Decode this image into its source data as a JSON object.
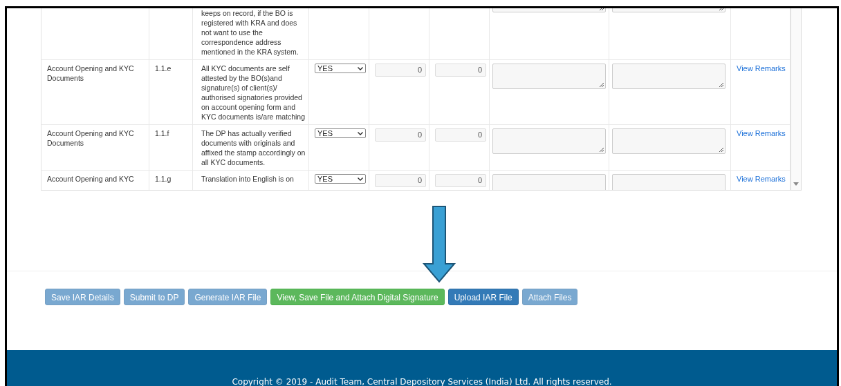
{
  "table": {
    "rows": [
      {
        "kind": "tail",
        "description": "keeps on record, if the BO is registered with KRA and does not want to use the correspondence address mentioned in the KRA system."
      },
      {
        "kind": "full",
        "area": "Account Opening and KYC Documents",
        "code": "1.1.e",
        "description": "All KYC documents are self attested by the BO(s)and signature(s) of client(s)/ authorised signatories provided on account opening form and KYC documents is/are matching",
        "answer": "YES",
        "value_1": "0",
        "value_2": "0",
        "link": "View Remarks"
      },
      {
        "kind": "full",
        "area": "Account Opening and KYC Documents",
        "code": "1.1.f",
        "description": "The DP has actually verified documents with originals and affixed the stamp accordingly on all KYC documents.",
        "answer": "YES",
        "value_1": "0",
        "value_2": "0",
        "link": "View Remarks"
      },
      {
        "kind": "cut",
        "area": "Account Opening and KYC",
        "code": "1.1.g",
        "description": "Translation into English is on",
        "answer": "YES",
        "value_1": "0",
        "value_2": "0",
        "link": "View Remarks"
      }
    ]
  },
  "buttons": [
    {
      "label": "Save IAR Details",
      "kind": "primary",
      "disabled": true
    },
    {
      "label": "Submit to DP",
      "kind": "primary",
      "disabled": true
    },
    {
      "label": "Generate IAR File",
      "kind": "primary",
      "disabled": true
    },
    {
      "label": "View, Save File and Attach Digital Signature",
      "kind": "success",
      "disabled": false
    },
    {
      "label": "Upload IAR File",
      "kind": "primary",
      "disabled": false
    },
    {
      "label": "Attach Files",
      "kind": "primary",
      "disabled": true
    }
  ],
  "footer": {
    "text": "Copyright © 2019 - Audit Team, Central Depository Services (India) Ltd. All rights reserved."
  }
}
